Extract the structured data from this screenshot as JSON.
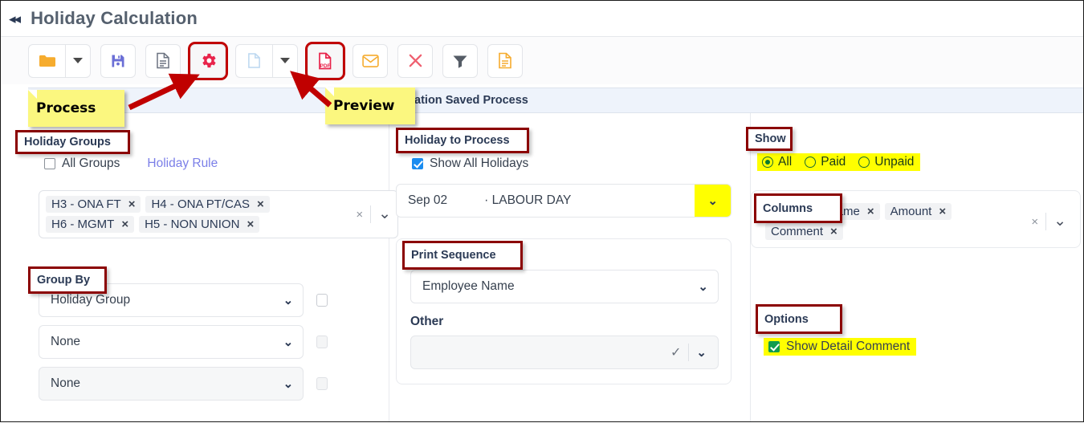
{
  "titlebar": {
    "collapse_icon": "◂◂",
    "title": "Holiday Calculation"
  },
  "toolbar": {
    "buttons": [
      {
        "name": "open-folder",
        "icon": "folder-icon"
      },
      {
        "name": "open-folder-dropdown",
        "icon": "chevron-down-icon"
      },
      {
        "name": "save",
        "icon": "floppy-disk-icon"
      },
      {
        "name": "report",
        "icon": "document-lines-icon"
      },
      {
        "name": "process",
        "icon": "gear-icon",
        "highlighted": true
      },
      {
        "name": "new-page",
        "icon": "blank-page-icon"
      },
      {
        "name": "new-page-dropdown",
        "icon": "chevron-down-icon"
      },
      {
        "name": "preview-pdf",
        "icon": "pdf-icon",
        "highlighted": true
      },
      {
        "name": "email",
        "icon": "envelope-icon"
      },
      {
        "name": "delete",
        "icon": "x-close-icon"
      },
      {
        "name": "filter",
        "icon": "funnel-icon"
      },
      {
        "name": "export-document",
        "icon": "document-orange-icon"
      }
    ],
    "pdf_label": "PDF"
  },
  "banner": {
    "title": "Holiday Calculation Saved Process"
  },
  "callouts": [
    {
      "name": "process-sticky",
      "text": "Process"
    },
    {
      "name": "preview-sticky",
      "text": "Preview"
    }
  ],
  "holiday_groups": {
    "label": "Holiday Groups",
    "all_groups_label": "All Groups",
    "all_groups_checked": false,
    "holiday_rule_link": "Holiday Rule",
    "chips": [
      "H3 - ONA FT",
      "H4 - ONA PT/CAS",
      "H6 - MGMT",
      "H5 - NON UNION"
    ],
    "clear_icon": "×",
    "chevron_icon": "⌄"
  },
  "group_by": {
    "label": "Group By",
    "rows": [
      {
        "value": "Holiday Group",
        "checked": false,
        "disabled": false
      },
      {
        "value": "None",
        "checked": false,
        "disabled": false
      },
      {
        "value": "None",
        "checked": false,
        "disabled": true
      }
    ],
    "chevron_icon": "⌄"
  },
  "holiday_to_process": {
    "label": "Holiday to Process",
    "show_all_label": "Show All Holidays",
    "show_all_checked": true,
    "selected_date": "Sep 02",
    "selected_name": "· LABOUR DAY",
    "chevron_icon": "⌄",
    "chevron_highlighted": true
  },
  "print_sequence": {
    "label": "Print Sequence",
    "selected": "Employee Name",
    "other_label": "Other",
    "other_value": "",
    "check_icon": "✓",
    "chevron_icon": "⌄"
  },
  "show": {
    "label": "Show",
    "options": [
      {
        "label": "All",
        "selected": true
      },
      {
        "label": "Paid",
        "selected": false
      },
      {
        "label": "Unpaid",
        "selected": false
      }
    ],
    "highlighted": true
  },
  "columns": {
    "label": "Columns",
    "chips": [
      "Employee Name",
      "Amount",
      "Comment"
    ],
    "clear_icon": "×",
    "chevron_icon": "⌄"
  },
  "options": {
    "label": "Options",
    "show_detail_comment_label": "Show Detail Comment",
    "show_detail_comment_checked": true,
    "highlighted": true
  },
  "colors": {
    "accent_blue": "#1a8cf0",
    "callout_red": "#8b0000",
    "sticky_yellow": "#fbf77f",
    "highlight_yellow": "#ffff00",
    "green_check": "#119c4e",
    "link_purple": "#7b7fe8",
    "folder_orange": "#f6ac2e",
    "gear_crimson": "#e8234a",
    "pdf_red": "#e8234a",
    "banner_blue": "#eef3fb"
  }
}
